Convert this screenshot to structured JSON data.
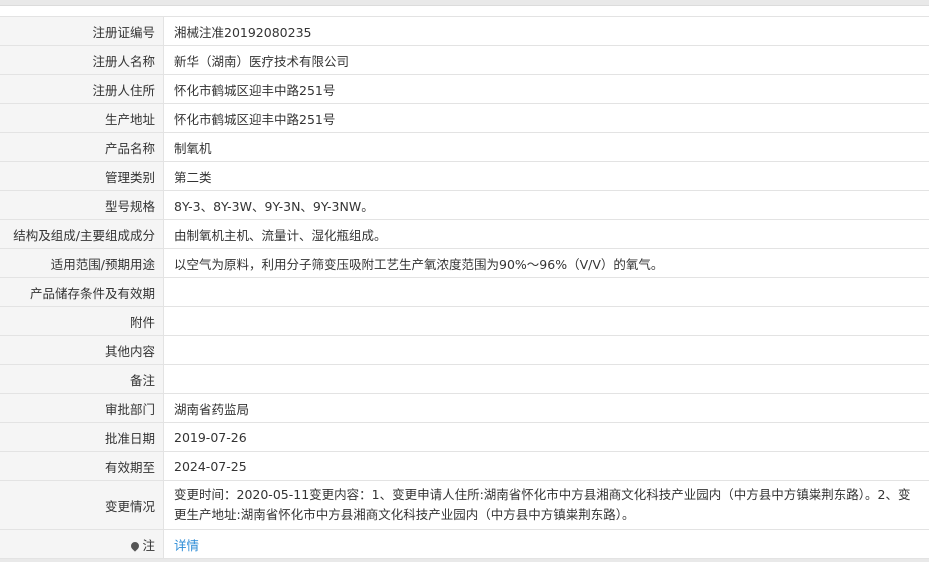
{
  "rows": [
    {
      "label": "注册证编号",
      "value": "湘械注准20192080235"
    },
    {
      "label": "注册人名称",
      "value": "新华（湖南）医疗技术有限公司"
    },
    {
      "label": "注册人住所",
      "value": "怀化市鹤城区迎丰中路251号"
    },
    {
      "label": "生产地址",
      "value": "怀化市鹤城区迎丰中路251号"
    },
    {
      "label": "产品名称",
      "value": "制氧机"
    },
    {
      "label": "管理类别",
      "value": "第二类"
    },
    {
      "label": "型号规格",
      "value": "8Y-3、8Y-3W、9Y-3N、9Y-3NW。"
    },
    {
      "label": "结构及组成/主要组成成分",
      "value": "由制氧机主机、流量计、湿化瓶组成。"
    },
    {
      "label": "适用范围/预期用途",
      "value": "以空气为原料，利用分子筛变压吸附工艺生产氧浓度范围为90%～96%（V/V）的氧气。"
    },
    {
      "label": "产品储存条件及有效期",
      "value": ""
    },
    {
      "label": "附件",
      "value": ""
    },
    {
      "label": "其他内容",
      "value": ""
    },
    {
      "label": "备注",
      "value": ""
    },
    {
      "label": "审批部门",
      "value": "湖南省药监局"
    },
    {
      "label": "批准日期",
      "value": "2019-07-26"
    },
    {
      "label": "有效期至",
      "value": "2024-07-25"
    },
    {
      "label": "变更情况",
      "value": "变更时间：2020-05-11变更内容：1、变更申请人住所:湖南省怀化市中方县湘商文化科技产业园内（中方县中方镇粜荆东路）。2、变更生产地址:湖南省怀化市中方县湘商文化科技产业园内（中方县中方镇粜荆东路）。"
    }
  ],
  "note": {
    "label": "注",
    "icon": "pin-icon",
    "link_text": "详情"
  }
}
